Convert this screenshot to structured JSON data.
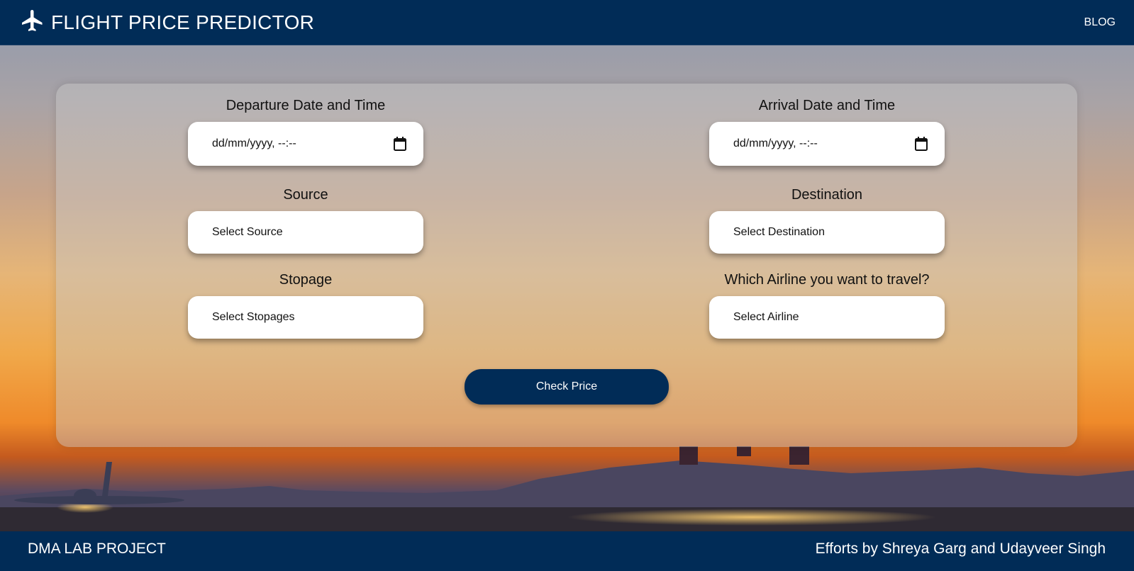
{
  "header": {
    "title": "FLIGHT PRICE PREDICTOR",
    "logo_icon": "airplane-icon",
    "nav_blog": "BLOG"
  },
  "form": {
    "departure": {
      "label": "Departure Date and Time",
      "placeholder": "dd/mm/yyyy, --:--",
      "icon": "calendar-icon"
    },
    "arrival": {
      "label": "Arrival Date and Time",
      "placeholder": "dd/mm/yyyy, --:--",
      "icon": "calendar-icon"
    },
    "source": {
      "label": "Source",
      "selected": "Select Source"
    },
    "destination": {
      "label": "Destination",
      "selected": "Select Destination"
    },
    "stopage": {
      "label": "Stopage",
      "selected": "Select Stopages"
    },
    "airline": {
      "label": "Which Airline you want to travel?",
      "selected": "Select Airline"
    },
    "submit_label": "Check Price"
  },
  "footer": {
    "left": "DMA LAB PROJECT",
    "right": "Efforts by Shreya Garg and Udayveer Singh"
  },
  "colors": {
    "primary": "#012c57",
    "card": "rgba(200,200,200,0.45)",
    "control": "#ffffff"
  }
}
